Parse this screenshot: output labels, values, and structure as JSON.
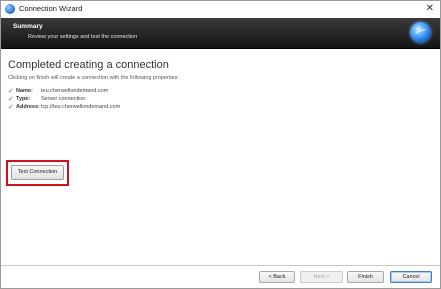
{
  "window": {
    "title": "Connection Wizard",
    "close_glyph": "✕",
    "icon": "app-globe-icon"
  },
  "banner": {
    "heading": "Summary",
    "subheading": "Review your settings and test the connection",
    "logo_icon": "globe-logo-icon"
  },
  "main": {
    "title": "Completed creating a connection",
    "intro": "Clicking on finish will create a connection with the following properties:",
    "properties": [
      {
        "check": "✓",
        "label": "Name:",
        "value": "teu.cherwellondemand.com"
      },
      {
        "check": "✓",
        "label": "Type:",
        "value": "Server connection"
      },
      {
        "check": "✓",
        "label": "Address:",
        "value": "tcp://teu.cherwellondemand.com"
      }
    ],
    "test_button_label": "Test Connection"
  },
  "footer": {
    "back_label": "< Back",
    "next_label": "Next >",
    "finish_label": "Finish",
    "cancel_label": "Cancel"
  },
  "colors": {
    "highlight": "#d0101c",
    "check": "#2a62c8",
    "banner_bg": "#1e1e1e"
  }
}
